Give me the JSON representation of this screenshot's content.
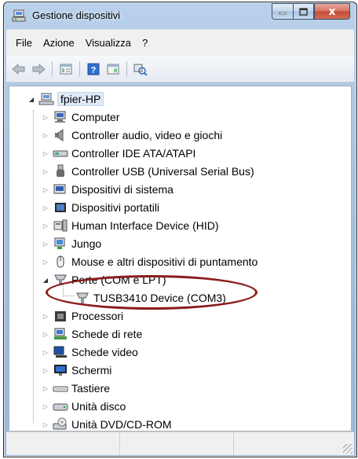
{
  "window": {
    "title": "Gestione dispositivi",
    "close_glyph": "x"
  },
  "menu": [
    "File",
    "Azione",
    "Visualizza",
    "?"
  ],
  "toolbar": {
    "icons": [
      "back-arrow-icon",
      "forward-arrow-icon",
      "properties-icon",
      "help-icon",
      "view-icon",
      "scan-hardware-icon"
    ]
  },
  "tree": {
    "root": "fpier-HP",
    "items": [
      {
        "label": "Computer",
        "icon": "computer-icon",
        "expander": "collapsed"
      },
      {
        "label": "Controller audio, video e giochi",
        "icon": "speaker-icon",
        "expander": "collapsed"
      },
      {
        "label": "Controller IDE ATA/ATAPI",
        "icon": "ide-controller-icon",
        "expander": "collapsed"
      },
      {
        "label": "Controller USB (Universal Serial Bus)",
        "icon": "usb-icon",
        "expander": "collapsed"
      },
      {
        "label": "Dispositivi di sistema",
        "icon": "system-device-icon",
        "expander": "collapsed"
      },
      {
        "label": "Dispositivi portatili",
        "icon": "portable-device-icon",
        "expander": "collapsed"
      },
      {
        "label": "Human Interface Device (HID)",
        "icon": "hid-icon",
        "expander": "collapsed"
      },
      {
        "label": "Jungo",
        "icon": "jungo-icon",
        "expander": "collapsed"
      },
      {
        "label": "Mouse e altri dispositivi di puntamento",
        "icon": "mouse-icon",
        "expander": "collapsed"
      },
      {
        "label": "Porte (COM e LPT)",
        "icon": "port-icon",
        "expander": "expanded"
      },
      {
        "label": "TUSB3410 Device (COM3)",
        "icon": "port-icon",
        "expander": "none",
        "child": true
      },
      {
        "label": "Processori",
        "icon": "processor-icon",
        "expander": "collapsed"
      },
      {
        "label": "Schede di rete",
        "icon": "network-card-icon",
        "expander": "collapsed"
      },
      {
        "label": "Schede video",
        "icon": "video-card-icon",
        "expander": "collapsed"
      },
      {
        "label": "Schermi",
        "icon": "monitor-icon",
        "expander": "collapsed"
      },
      {
        "label": "Tastiere",
        "icon": "keyboard-icon",
        "expander": "collapsed"
      },
      {
        "label": "Unità disco",
        "icon": "disk-drive-icon",
        "expander": "collapsed"
      },
      {
        "label": "Unità DVD/CD-ROM",
        "icon": "dvd-drive-icon",
        "expander": "collapsed"
      }
    ]
  },
  "colors": {
    "annotation": "#8a1c1c",
    "titlebar": "#a7c2df"
  }
}
